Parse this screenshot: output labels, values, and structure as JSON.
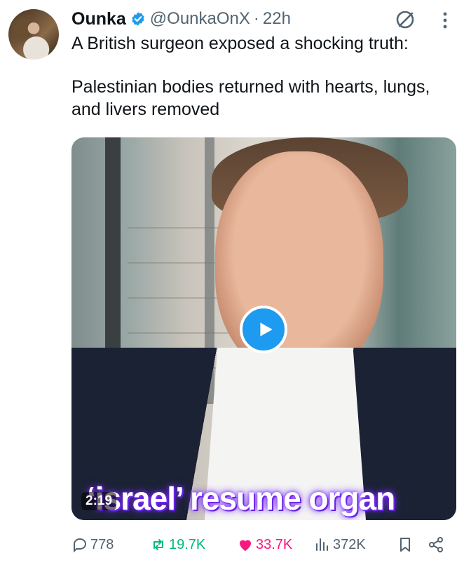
{
  "tweet": {
    "author_name": "Ounka",
    "handle": "@OunkaOnX",
    "separator": "·",
    "time": "22h",
    "text_lines": [
      "A British surgeon exposed a shocking truth:",
      "Palestinian bodies returned with hearts, lungs, and livers removed"
    ]
  },
  "video": {
    "caption": "‘israel’ resume organ",
    "duration": "2:19"
  },
  "stats": {
    "replies": "778",
    "reposts": "19.7K",
    "likes": "33.7K",
    "views": "372K"
  },
  "colors": {
    "accent": "#1d9bf0",
    "repost_active": "#00ba7c",
    "like_active": "#f91880",
    "muted_text": "#536471"
  },
  "icons": [
    "verified-badge-icon",
    "grok-icon",
    "more-icon",
    "play-icon",
    "reply-icon",
    "repost-icon",
    "heart-icon",
    "views-icon",
    "bookmark-icon",
    "share-icon"
  ]
}
